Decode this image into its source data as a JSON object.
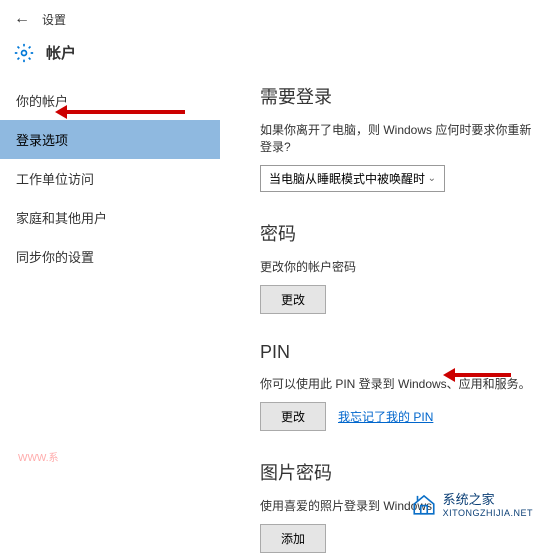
{
  "header": {
    "settings_label": "设置"
  },
  "title": {
    "page_title": "帐户"
  },
  "sidebar": {
    "items": [
      {
        "label": "你的帐户"
      },
      {
        "label": "登录选项"
      },
      {
        "label": "工作单位访问"
      },
      {
        "label": "家庭和其他用户"
      },
      {
        "label": "同步你的设置"
      }
    ]
  },
  "sections": {
    "require_signin": {
      "title": "需要登录",
      "desc": "如果你离开了电脑，则 Windows 应何时要求你重新登录?",
      "dropdown_value": "当电脑从睡眠模式中被唤醒时"
    },
    "password": {
      "title": "密码",
      "desc": "更改你的帐户密码",
      "change_btn": "更改"
    },
    "pin": {
      "title": "PIN",
      "desc": "你可以使用此 PIN 登录到 Windows、应用和服务。",
      "change_btn": "更改",
      "forgot_link": "我忘记了我的 PIN"
    },
    "picture_password": {
      "title": "图片密码",
      "desc": "使用喜爱的照片登录到 Windows",
      "add_btn": "添加"
    }
  },
  "watermark": {
    "left": "WWW.系",
    "right_text": "系统之家",
    "right_sub": "XITONGZHIJIA.NET"
  }
}
